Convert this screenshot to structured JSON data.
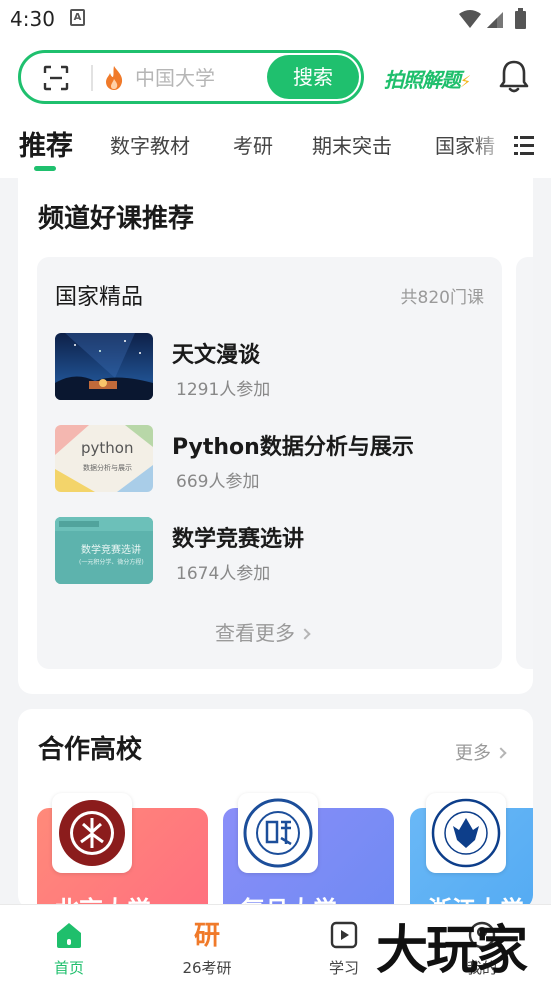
{
  "status_bar": {
    "time": "4:30",
    "notification_icon": "A"
  },
  "search": {
    "placeholder": "中国大学",
    "button_label": "搜索",
    "photo_solve_label": "拍照解题",
    "photo_solve_mark": "⚡"
  },
  "tabs": [
    {
      "label": "推荐",
      "active": true
    },
    {
      "label": "数字教材"
    },
    {
      "label": "考研"
    },
    {
      "label": "期末突击"
    },
    {
      "label": "国家精"
    }
  ],
  "channel": {
    "title": "频道好课推荐",
    "panel_title": "国家精品",
    "panel_count": "共820门课",
    "courses": [
      {
        "name": "天文漫谈",
        "participants": "1291人参加"
      },
      {
        "name": "Python数据分析与展示",
        "participants": "669人参加",
        "thumb_title": "python",
        "thumb_subtitle": "数据分析与展示"
      },
      {
        "name": "数学竞赛选讲",
        "participants": "1674人参加",
        "thumb_title": "数学竞赛选讲",
        "thumb_subtitle": "(一元积分学、微分方程)"
      }
    ],
    "more_label": "查看更多"
  },
  "partners": {
    "title": "合作高校",
    "more_label": "更多",
    "universities": [
      {
        "name": "北京大学",
        "color": "#ff6f6f"
      },
      {
        "name": "复旦大学",
        "color": "#7b86f6"
      },
      {
        "name": "浙江大学",
        "color": "#5fb4f5"
      }
    ]
  },
  "bottom_nav": [
    {
      "label": "首页",
      "icon": "home-icon",
      "active": true
    },
    {
      "label": "26考研",
      "icon": "研"
    },
    {
      "label": "学习",
      "icon": "play-icon"
    },
    {
      "label": "我的",
      "icon": "profile-icon"
    }
  ],
  "watermark": "大玩家",
  "colors": {
    "accent": "#1fc06e",
    "orange": "#f07a2a"
  }
}
